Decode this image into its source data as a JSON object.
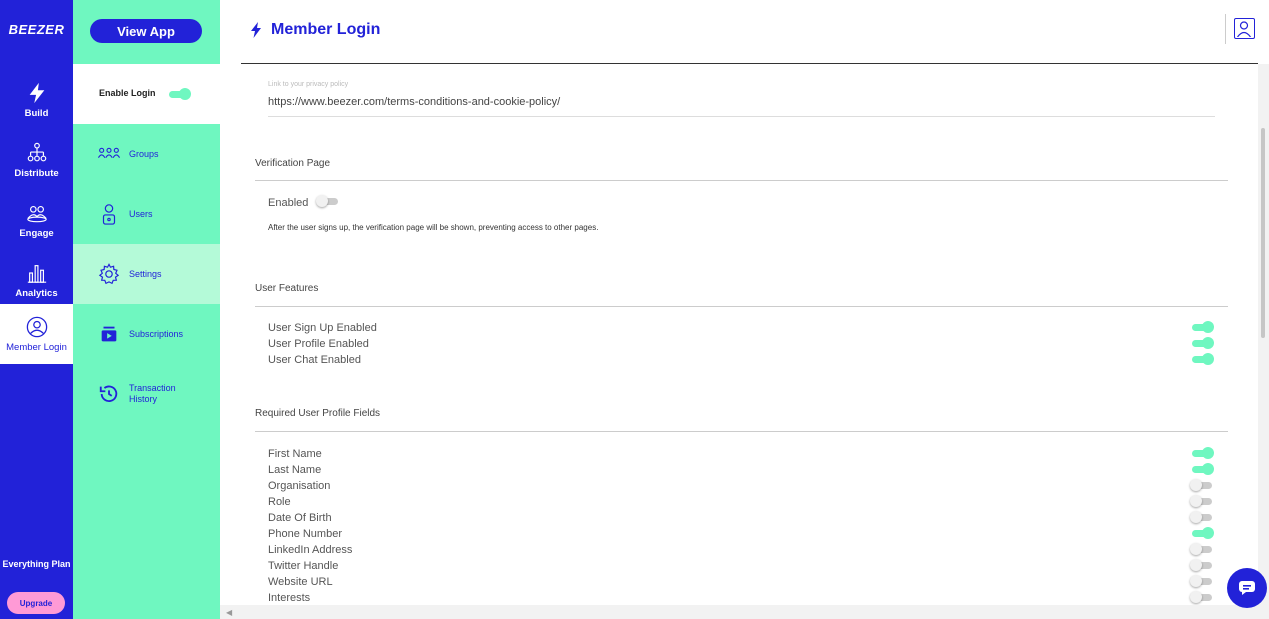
{
  "rail": {
    "logo": "BEEZER",
    "items": [
      {
        "label": "Build",
        "icon": "bolt-icon"
      },
      {
        "label": "Distribute",
        "icon": "hierarchy-icon"
      },
      {
        "label": "Engage",
        "icon": "people-icon"
      },
      {
        "label": "Analytics",
        "icon": "bar-chart-icon"
      },
      {
        "label": "Member Login",
        "icon": "user-circle-icon"
      }
    ],
    "plan": "Everything Plan",
    "upgrade": "Upgrade"
  },
  "side": {
    "view_app": "View App",
    "enable_login": "Enable Login",
    "items": [
      {
        "label": "Groups",
        "icon": "groups-icon"
      },
      {
        "label": "Users",
        "icon": "user-lock-icon"
      },
      {
        "label": "Settings",
        "icon": "gear-icon"
      },
      {
        "label": "Subscriptions",
        "icon": "subscriptions-icon"
      },
      {
        "label": "Transaction History",
        "icon": "history-icon"
      }
    ]
  },
  "header": {
    "title": "Member Login"
  },
  "privacy": {
    "label": "Link to your privacy policy",
    "value": "https://www.beezer.com/terms-conditions-and-cookie-policy/"
  },
  "verification": {
    "title": "Verification Page",
    "enabled_label": "Enabled",
    "help": "After the user signs up, the verification page will be shown, preventing access to other pages."
  },
  "user_features": {
    "title": "User Features",
    "items": [
      {
        "label": "User Sign Up Enabled",
        "on": true
      },
      {
        "label": "User Profile Enabled",
        "on": true
      },
      {
        "label": "User Chat Enabled",
        "on": true
      }
    ]
  },
  "required_fields": {
    "title": "Required User Profile Fields",
    "items": [
      {
        "label": "First Name",
        "on": true
      },
      {
        "label": "Last Name",
        "on": true
      },
      {
        "label": "Organisation",
        "on": false
      },
      {
        "label": "Role",
        "on": false
      },
      {
        "label": "Date Of Birth",
        "on": false
      },
      {
        "label": "Phone Number",
        "on": true
      },
      {
        "label": "LinkedIn Address",
        "on": false
      },
      {
        "label": "Twitter Handle",
        "on": false
      },
      {
        "label": "Website URL",
        "on": false
      },
      {
        "label": "Interests",
        "on": false
      }
    ]
  },
  "colors": {
    "brand_blue": "#2222d8",
    "mint": "#6ff7c0",
    "pink": "#ff9ad6"
  }
}
